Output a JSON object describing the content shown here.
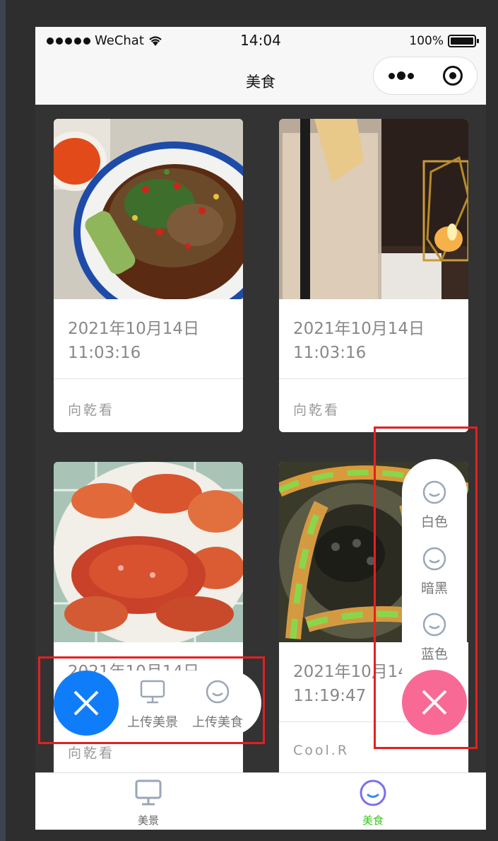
{
  "status_bar": {
    "carrier": "WeChat",
    "time": "14:04",
    "battery": "100%"
  },
  "nav": {
    "title": "美食"
  },
  "cards": [
    {
      "date": "2021年10月14日 11:03:16",
      "author": "向乾看"
    },
    {
      "date": "2021年10月14日 11:03:16",
      "author": "向乾看"
    },
    {
      "date": "2021年10月14日",
      "author": "向乾看"
    },
    {
      "date": "2021年10月14 11:19:47",
      "author": "Cool.R"
    }
  ],
  "fab_left": {
    "items": [
      "上传美景",
      "上传美食"
    ]
  },
  "fab_right": {
    "items": [
      "白色",
      "暗黑",
      "蓝色"
    ]
  },
  "tabbar": {
    "items": [
      "美景",
      "美食"
    ],
    "active": "美食"
  },
  "colors": {
    "active_tab": "#3cc51f",
    "fab_blue": "#0f7dfa",
    "fab_pink": "#f86a95",
    "annotation_red": "#e32020",
    "icon_gray": "#9aa6b8",
    "tab_active_icon": "#7a6ef0"
  }
}
